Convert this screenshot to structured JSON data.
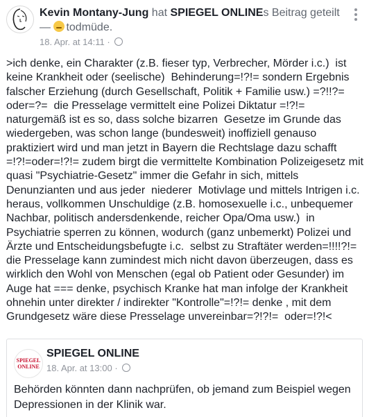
{
  "post": {
    "author": "Kevin Montany-Jung",
    "action_word": "hat",
    "shared_page": "SPIEGEL ONLINE",
    "action_suffix": "s Beitrag geteilt",
    "feeling_prefix": "—",
    "feeling": "todmüde.",
    "timestamp": "18. Apr. at 14:11",
    "separator": "·",
    "body": ">ich denke, ein Charakter (z.B. fieser typ, Verbrecher, Mörder i.c.)  ist\nkeine Krankheit oder (seelische)  Behinderung=!?!= sondern Ergebnis\nfalscher Erziehung (durch Gesellschaft, Politik + Familie usw.) =?!!?=\noder=?=  die Presselage vermittelt eine Polizei Diktatur =!?!=\nnaturgemäß ist es so, dass solche bizarren  Gesetze im Grunde das\nwiedergeben, was schon lange (bundesweit) inoffiziell genauso\npraktiziert wird und man jetzt in Bayern die Rechtslage dazu schafft\n=!?!=oder=!?!= zudem birgt die vermittelte Kombination Polizeigesetz mit\nquasi \"Psychiatrie-Gesetz\" immer die Gefahr in sich, mittels\nDenunzianten und aus jeder  niederer  Motivlage und mittels Intrigen i.c.\nheraus, vollkommen Unschuldige (z.B. homosexuelle i.c., unbequemer\nNachbar, politisch andersdenkende, reicher Opa/Oma usw.)  in\nPsychiatrie sperren zu können, wodurch (ganz unbemerkt) Polizei und\nÄrzte und Entscheidungsbefugte i.c.  selbst zu Straftäter werden=!!!!?!=\ndie Presselage kann zumindest mich nicht davon überzeugen, dass es\nwirklich den Wohl von Menschen (egal ob Patient oder Gesunder) im\nAuge hat === denke, psychisch Kranke hat man infolge der Krankheit\nohnehin unter direkter / indirekter \"Kontrolle\"=!?!= denke , mit dem\nGrundgesetz wäre diese Presselage unvereinbar=?!?!=  oder=!?!<"
  },
  "shared_post": {
    "logo_line1": "SPIEGEL",
    "logo_line2": "ONLINE",
    "page_name": "SPIEGEL ONLINE",
    "timestamp": "18. Apr. at 13:00",
    "separator": "·",
    "text": "Behörden könnten dann nachprüfen, ob jemand zum Beispiel wegen\nDepressionen in der Klinik war."
  },
  "icons": {
    "privacy": "globe-icon",
    "menu": "more-options-icon",
    "feeling": "sleepy-face-icon"
  },
  "colors": {
    "text": "#1d2129",
    "secondary": "#616770",
    "meta": "#90949c",
    "spiegel_red": "#c8102e"
  }
}
